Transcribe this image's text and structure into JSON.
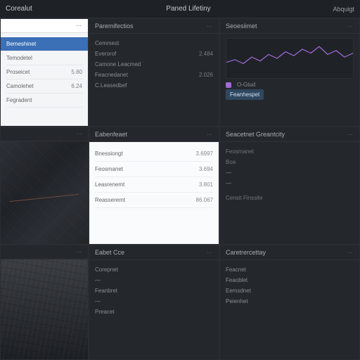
{
  "header": {
    "title": "Corealut",
    "center": "Paned Lifetiny",
    "right": "Abquigt"
  },
  "colors": {
    "accent": "#3b6fb6",
    "chartline": "#a06ad8"
  },
  "col1": {
    "panel1": {
      "title": "",
      "items": [
        {
          "label": "Bemeshinet",
          "value": "",
          "selected": true
        },
        {
          "label": "Temodetel",
          "value": ""
        },
        {
          "label": "Proseicet",
          "value": "5.80"
        },
        {
          "label": "Camolehet",
          "value": "6.24"
        },
        {
          "label": "Fegradent",
          "value": ""
        }
      ]
    },
    "panel2": {
      "title": ""
    },
    "panel3": {
      "title": ""
    }
  },
  "col2": {
    "panel1": {
      "title": "Paremifectios",
      "items": [
        {
          "label": "Cemmest",
          "value": ""
        },
        {
          "label": "Everorof",
          "value": "2.484"
        },
        {
          "label": "Camone Leacmed",
          "value": ""
        },
        {
          "label": "Feacnedanet",
          "value": "2.026"
        },
        {
          "label": "C.Leasedbef",
          "value": ""
        }
      ]
    },
    "panel2": {
      "title": "Eabenfeaet",
      "items": [
        {
          "label": "Bnessiongt",
          "value": "3.6997"
        },
        {
          "label": "Feosmanet",
          "value": "3.694"
        },
        {
          "label": "Leasrenemt",
          "value": "3.801"
        },
        {
          "label": "Reasseremt",
          "value": "86.067"
        }
      ]
    },
    "panel3": {
      "title": "Eabet Cce",
      "items": [
        {
          "label": "Corepnet",
          "value": ""
        },
        {
          "label": "—",
          "value": ""
        },
        {
          "label": "Feanbret",
          "value": ""
        },
        {
          "label": "—",
          "value": ""
        },
        {
          "label": "Preacet",
          "value": ""
        }
      ]
    }
  },
  "col3": {
    "panel1": {
      "title": "Seoesiimet",
      "legend": [
        {
          "name": "O-Gtud",
          "color": "#a06ad8"
        }
      ],
      "button": "Feanhespet"
    },
    "panel2": {
      "title": "Seacetnet Greantcity",
      "sub1": "Feosmanet",
      "sub2": "Boa",
      "items": [
        {
          "label": "—",
          "value": ""
        },
        {
          "label": "—",
          "value": ""
        }
      ],
      "footer": "Censit Finssite"
    },
    "panel3": {
      "title": "Caretrercettay",
      "items": [
        {
          "label": "Feacnet",
          "value": ""
        },
        {
          "label": "Feaoblet",
          "value": ""
        },
        {
          "label": "Eemsdnet",
          "value": ""
        },
        {
          "label": "Peienhet",
          "value": ""
        }
      ]
    }
  },
  "chart_data": {
    "type": "line",
    "title": "",
    "xlabel": "",
    "ylabel": "",
    "x": [
      0,
      1,
      2,
      3,
      4,
      5,
      6,
      7,
      8,
      9,
      10,
      11,
      12,
      13,
      14,
      15
    ],
    "series": [
      {
        "name": "O-Gtud",
        "color": "#a06ad8",
        "values": [
          32,
          34,
          31,
          36,
          33,
          38,
          35,
          40,
          37,
          42,
          39,
          44,
          38,
          41,
          36,
          39
        ]
      }
    ],
    "ylim": [
      20,
      50
    ]
  }
}
